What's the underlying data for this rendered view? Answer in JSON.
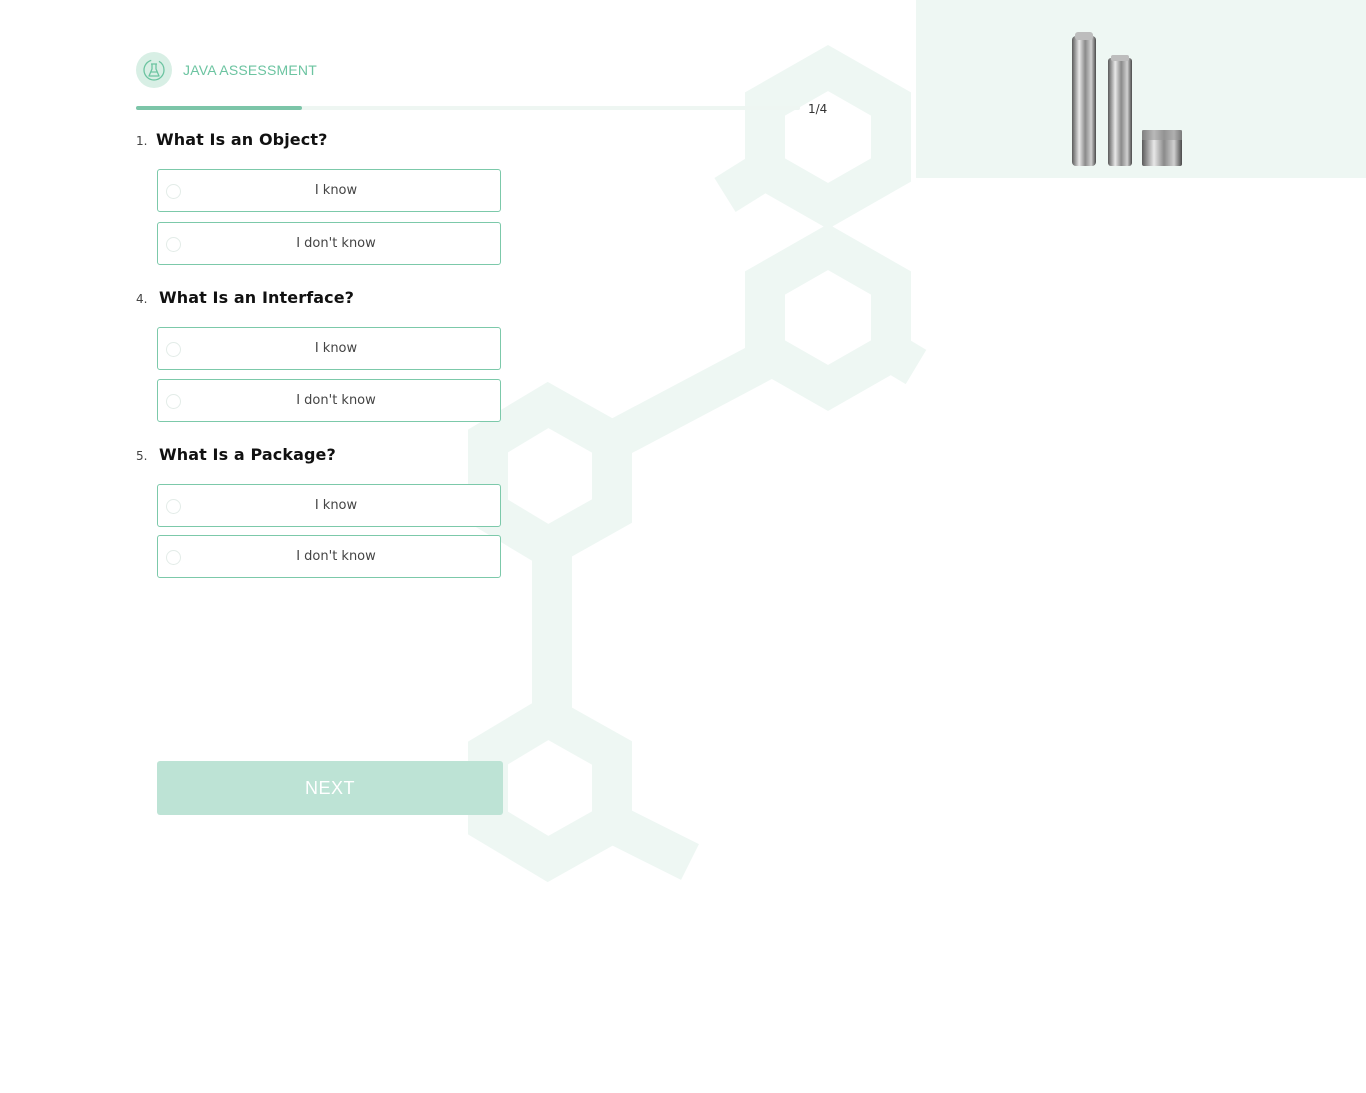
{
  "header": {
    "logo_icon": "flask-cycle-icon",
    "title": "JAVA ASSESSMENT"
  },
  "progress": {
    "current": 1,
    "total": 4,
    "label": "1/4",
    "fill_fraction": 0.25
  },
  "questions": [
    {
      "number": "1.",
      "text": "What Is an Object?",
      "options": [
        {
          "label": "I know",
          "selected": false
        },
        {
          "label": "I don't know",
          "selected": false
        }
      ]
    },
    {
      "number": "4.",
      "text": "What Is an Interface?",
      "options": [
        {
          "label": "I know",
          "selected": false
        },
        {
          "label": "I don't know",
          "selected": false
        }
      ]
    },
    {
      "number": "5.",
      "text": "What Is a Package?",
      "options": [
        {
          "label": "I know",
          "selected": false
        },
        {
          "label": "I don't know",
          "selected": false
        }
      ]
    }
  ],
  "actions": {
    "next_label": "NEXT"
  },
  "colors": {
    "accent": "#7cc9aa",
    "accent_text": "#6cc4a1",
    "button_disabled": "#bde3d5",
    "hero_bg": "#eef7f3"
  },
  "hero": {
    "image": "skincare-product-bottles"
  }
}
